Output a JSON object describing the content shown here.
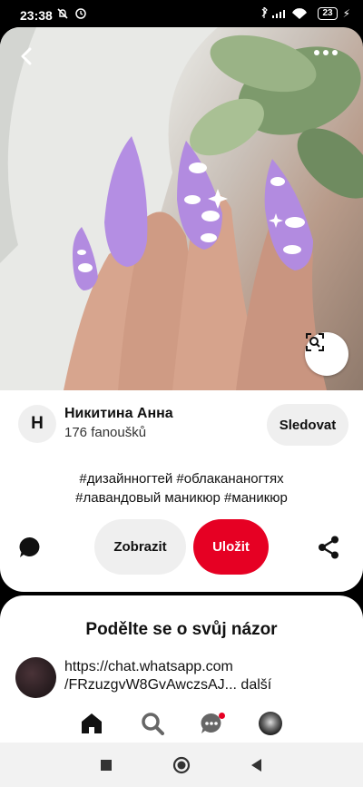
{
  "status_bar": {
    "time": "23:38",
    "battery": "23"
  },
  "pin": {
    "image_subject": "lavender-almond-nails-with-white-clouds",
    "author": {
      "avatar_letter": "H",
      "name": "Никитина Анна",
      "followers": "176 fanoušků"
    },
    "follow_label": "Sledovat",
    "description_line1": "#дизайнногтей #облакананогтях",
    "description_line2": "#лавандовый маникюр #маникюр",
    "visit_label": "Zobrazit",
    "save_label": "Uložit"
  },
  "opinion": {
    "title": "Podělte se o svůj názor",
    "comment_line1": "https://chat.whatsapp.com",
    "comment_line2": "/FRzuzgvW8GvAwczsAJ...",
    "more_label": "další"
  },
  "colors": {
    "accent_red": "#e60023",
    "button_gray": "#efefef"
  },
  "icons": [
    "back-icon",
    "more-icon",
    "visual-search-icon",
    "comment-icon",
    "share-icon",
    "home-icon",
    "search-icon",
    "messages-icon"
  ]
}
